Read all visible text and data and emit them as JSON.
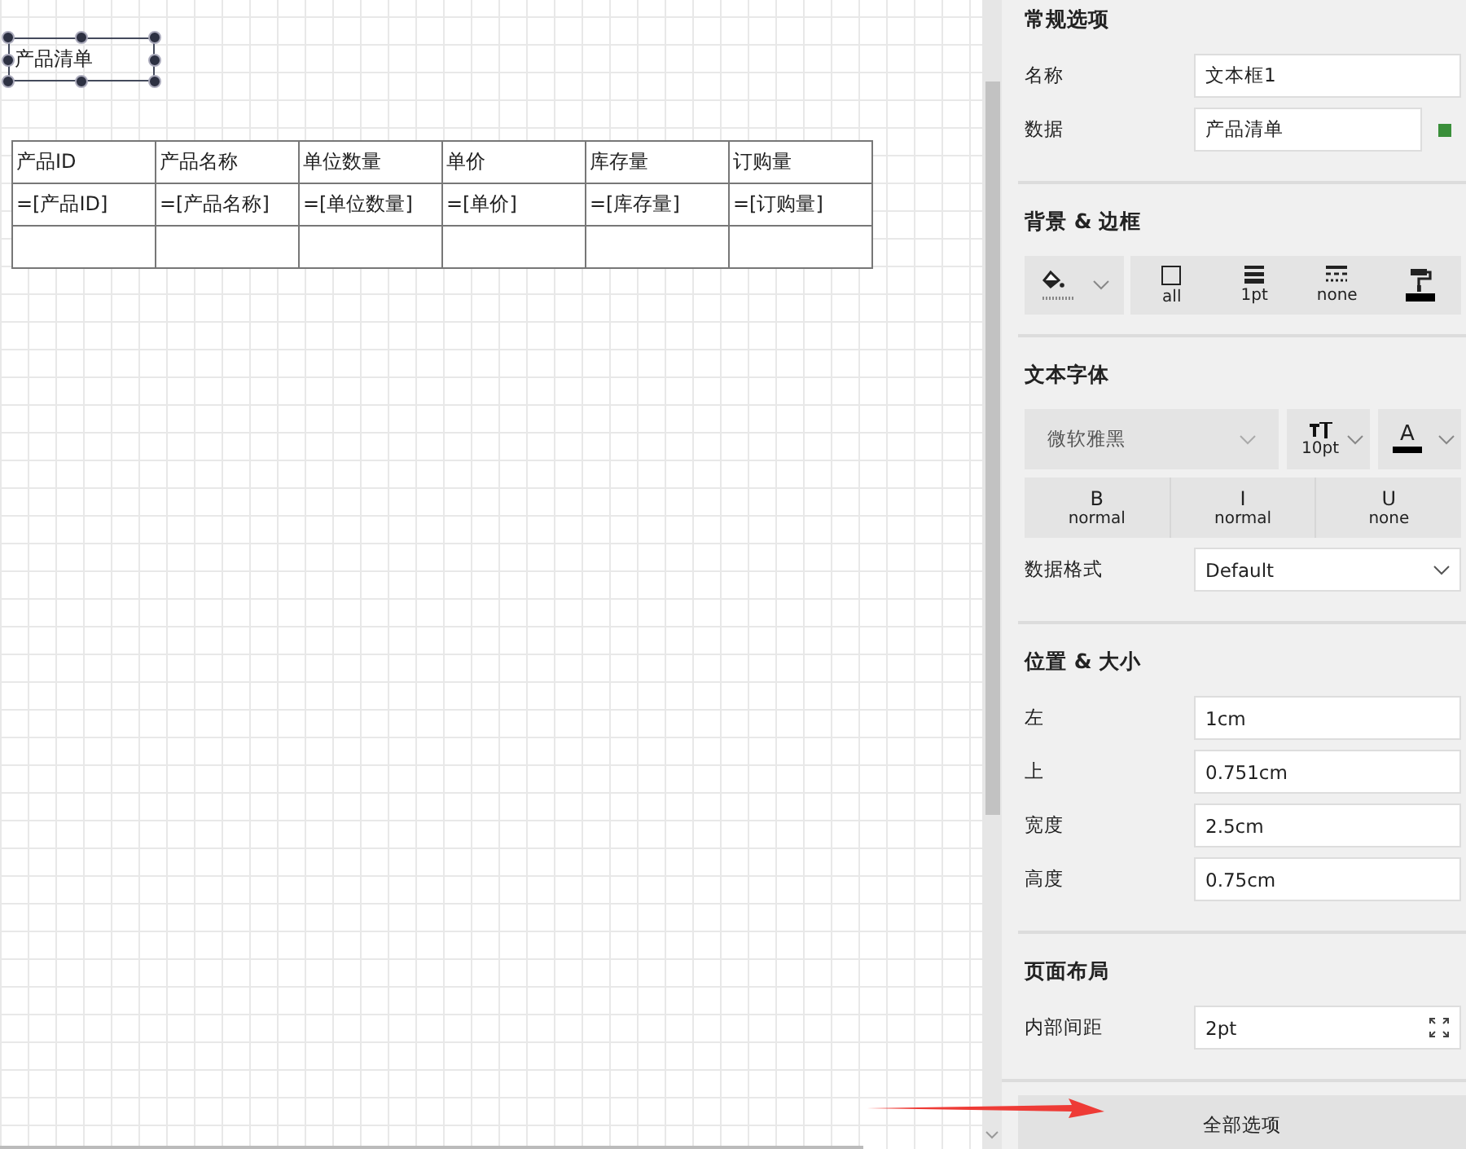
{
  "canvas": {
    "textbox": {
      "text": "产品清单",
      "selected": true
    },
    "table": {
      "columns": [
        "产品ID",
        "产品名称",
        "单位数量",
        "单价",
        "库存量",
        "订购量"
      ],
      "rows": [
        [
          "=[产品ID]",
          "=[产品名称]",
          "=[单位数量]",
          "=[单价]",
          "=[库存量]",
          "=[订购量]"
        ]
      ],
      "blank_row": true
    }
  },
  "general": {
    "title": "常规选项",
    "fields": [
      {
        "label": "名称",
        "value": "文本框1",
        "indicator": false
      },
      {
        "label": "数据",
        "value": "产品清单",
        "indicator": true
      }
    ]
  },
  "background_border": {
    "title": "背景 & 边框",
    "border_buttons": [
      {
        "kind": "style",
        "label": "all"
      },
      {
        "kind": "width",
        "label": "1pt"
      },
      {
        "kind": "dash",
        "label": "none"
      },
      {
        "kind": "color"
      }
    ]
  },
  "text_font": {
    "title": "文本字体",
    "font": "微软雅黑",
    "size": "10pt",
    "color_letter": "A",
    "style_buttons": [
      {
        "glyph": "B",
        "label": "normal"
      },
      {
        "glyph": "I",
        "label": "normal"
      },
      {
        "glyph": "U",
        "label": "none"
      }
    ],
    "format": {
      "label": "数据格式",
      "value": "Default"
    }
  },
  "position_size": {
    "title": "位置 & 大小",
    "fields": [
      {
        "label": "左",
        "value": "1cm"
      },
      {
        "label": "上",
        "value": "0.751cm"
      },
      {
        "label": "宽度",
        "value": "2.5cm"
      },
      {
        "label": "高度",
        "value": "0.75cm"
      }
    ]
  },
  "page_layout": {
    "title": "页面布局",
    "fields": [
      {
        "label": "内部间距",
        "value": "2pt"
      }
    ]
  },
  "all_options_button": "全部选项"
}
